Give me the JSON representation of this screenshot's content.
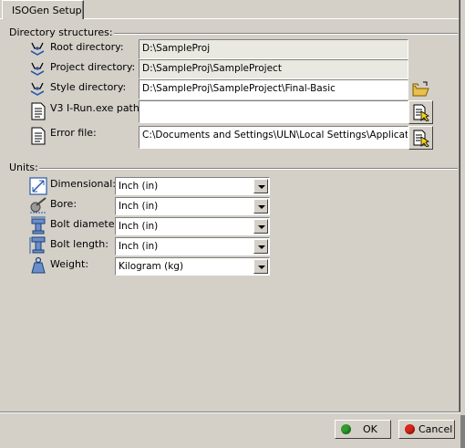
{
  "tab": {
    "label": "ISOGen Setup"
  },
  "directory_group": {
    "title": "Directory structures:",
    "rows": [
      {
        "label": "Root directory:",
        "value": "D:\\SampleProj",
        "icon": "root-directory-icon"
      },
      {
        "label": "Project directory:",
        "value": "D:\\SampleProj\\SampleProject",
        "icon": "project-directory-icon"
      },
      {
        "label": "Style directory:",
        "value": "D:\\SampleProj\\SampleProject\\Final-Basic",
        "icon": "style-directory-icon"
      },
      {
        "label": "V3 I-Run.exe path:",
        "value": "",
        "icon": "document-icon"
      },
      {
        "label": "Error file:",
        "value": "C:\\Documents and Settings\\ULN\\Local Settings\\Application D",
        "icon": "document-icon"
      }
    ]
  },
  "units_group": {
    "title": "Units:",
    "rows": [
      {
        "label": "Dimensional:",
        "value": "Inch (in)",
        "icon": "dimension-icon"
      },
      {
        "label": "Bore:",
        "value": "Inch (in)",
        "icon": "bore-icon"
      },
      {
        "label": "Bolt diameter:",
        "value": "Inch (in)",
        "icon": "bolt-diameter-icon"
      },
      {
        "label": "Bolt length:",
        "value": "Inch (in)",
        "icon": "bolt-length-icon"
      },
      {
        "label": "Weight:",
        "value": "Kilogram (kg)",
        "icon": "weight-icon"
      }
    ]
  },
  "buttons": {
    "ok": "OK",
    "cancel": "Cancel"
  },
  "colors": {
    "ok_dot": "#2e9d2e",
    "cancel_dot": "#d8261c",
    "panel": "#d4d0c8"
  }
}
